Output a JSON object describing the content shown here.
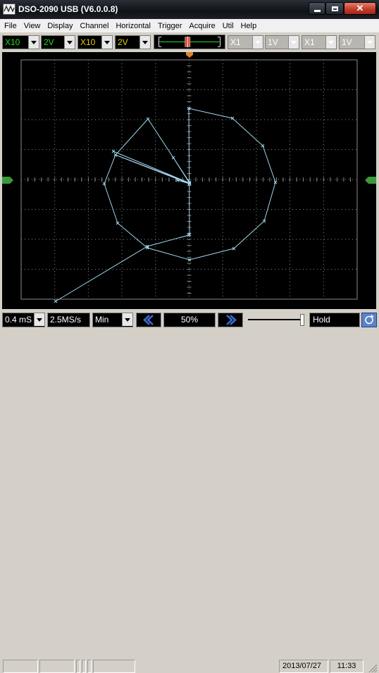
{
  "window": {
    "title": "DSO-2090 USB (V6.0.0.8)"
  },
  "menu": [
    "File",
    "View",
    "Display",
    "Channel",
    "Horizontal",
    "Trigger",
    "Acquire",
    "Util",
    "Help"
  ],
  "toolbar": {
    "ch1_probe": "X10",
    "ch1_volts": "2V",
    "ch2_probe": "X10",
    "ch2_volts": "2V",
    "ch3_probe": "X1",
    "ch3_volts": "1V",
    "ch4_probe": "X1",
    "ch4_volts": "1V"
  },
  "bottom": {
    "timebase": "0.4 mS",
    "sample_rate": "2.5MS/s",
    "mode": "Min",
    "position_percent": "50%",
    "hold": "Hold"
  },
  "status": {
    "date": "2013/07/27",
    "time": "11:33"
  },
  "colors": {
    "trace": "#9fd6ee",
    "grid": "#8a8a8a",
    "ch1_marker": "#3a9a3a",
    "ch2_marker": "#3a9a3a",
    "ch1_text": "#1fe01f",
    "ch2_text": "#e0d000"
  }
}
